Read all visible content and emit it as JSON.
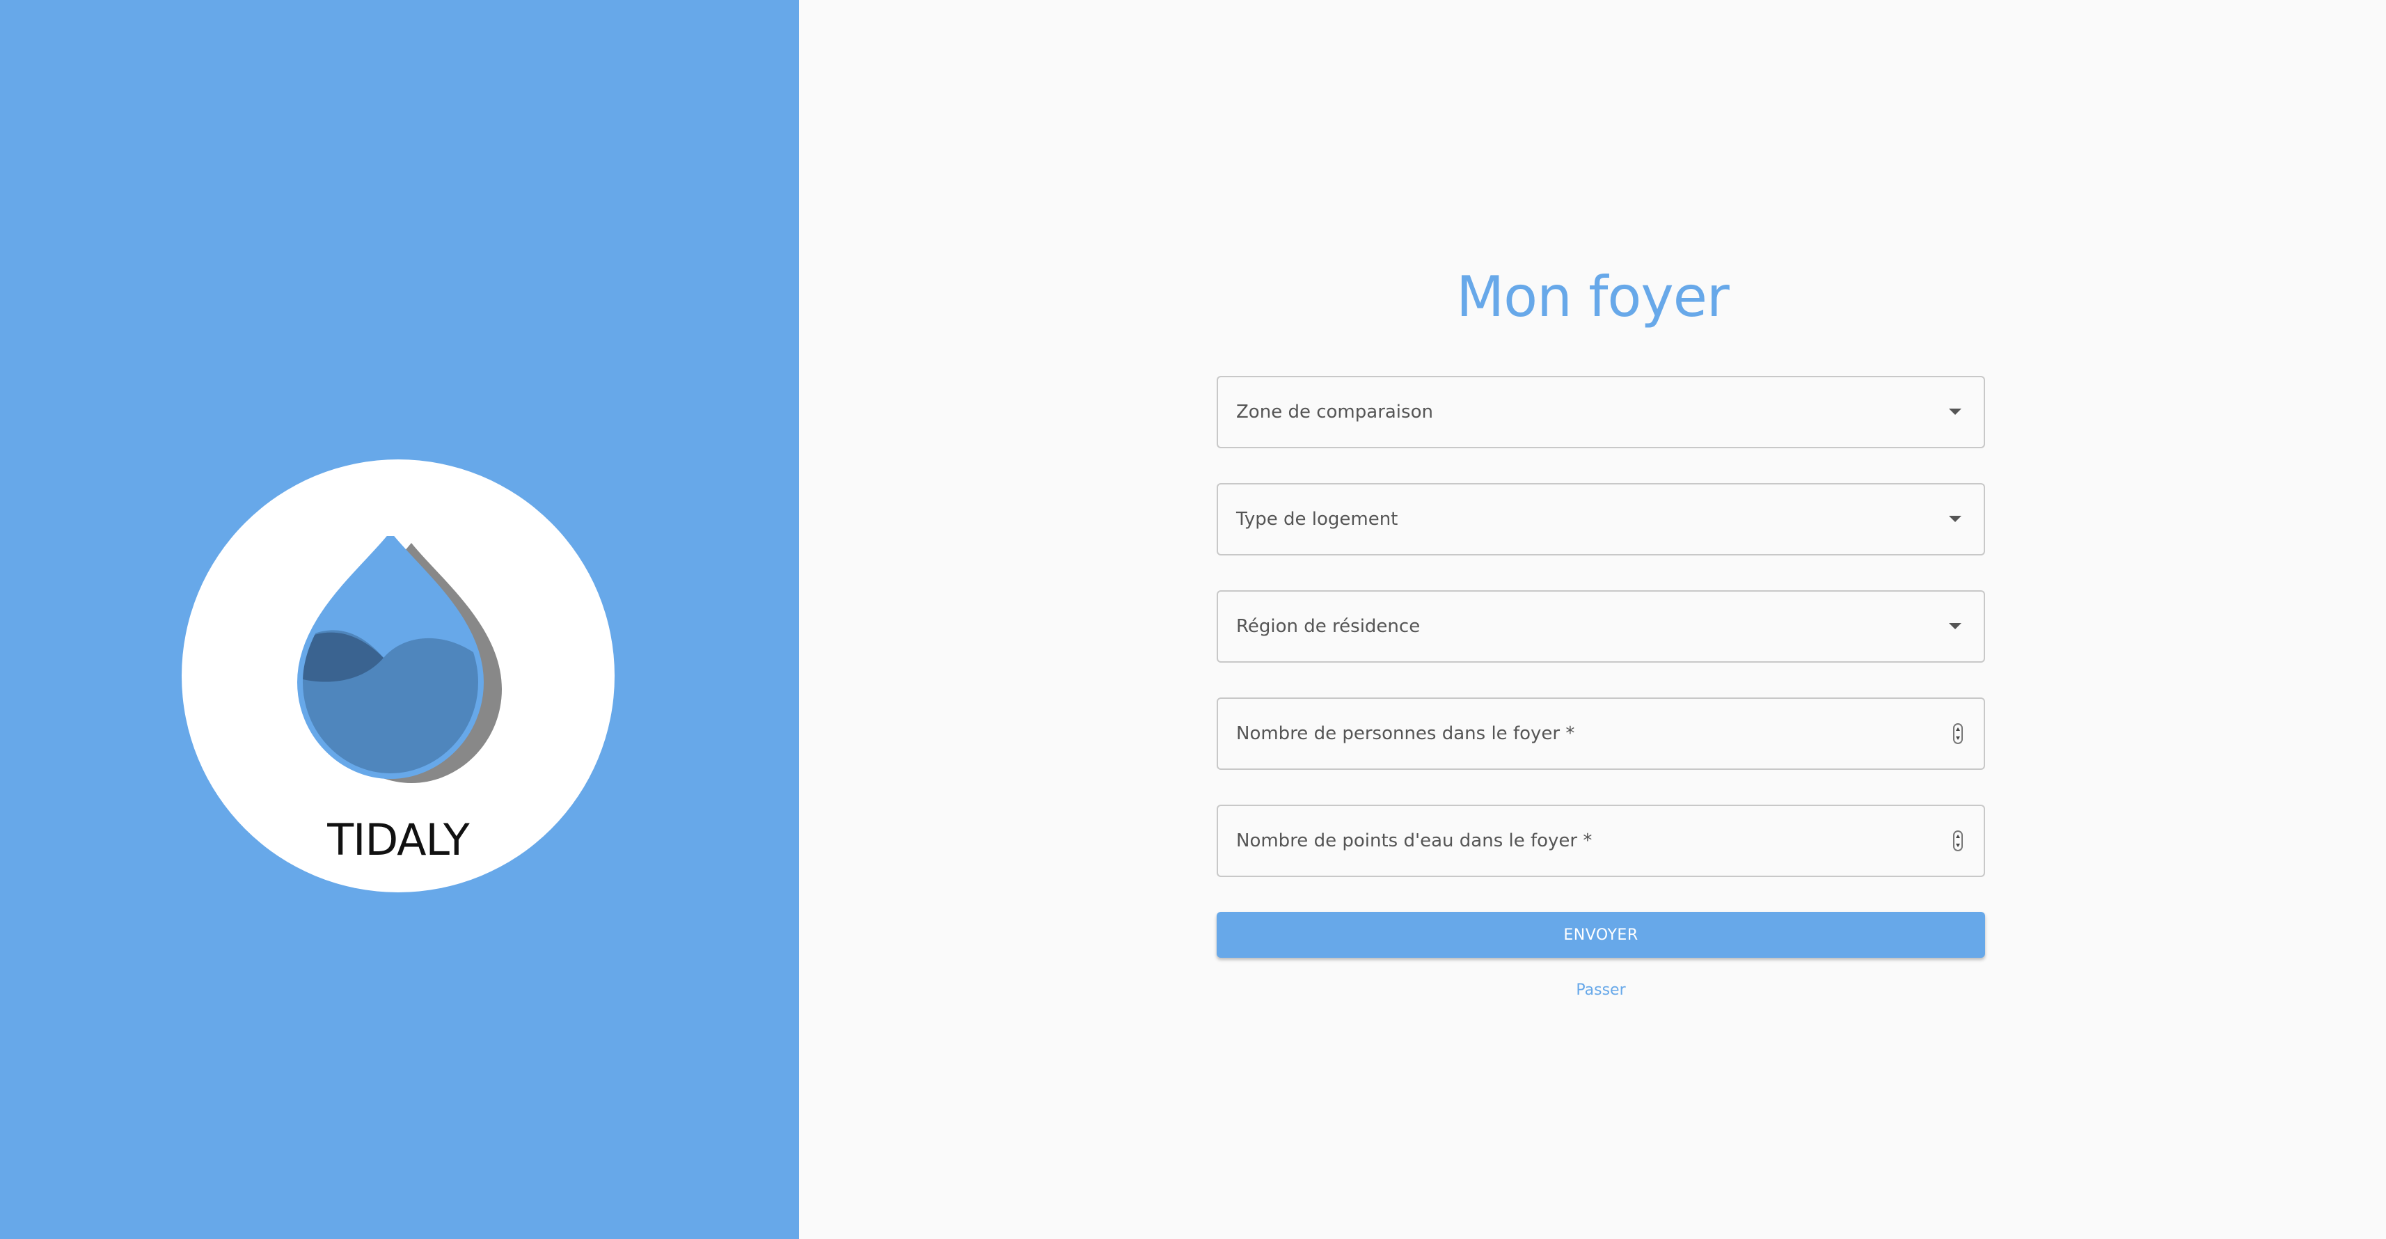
{
  "brand": {
    "name": "TIDALY",
    "logo_icon": "water-drop-icon",
    "accent_color": "#67a8e9"
  },
  "page": {
    "title": "Mon foyer"
  },
  "form": {
    "fields": [
      {
        "label": "Zone de comparaison",
        "type": "select"
      },
      {
        "label": "Type de logement",
        "type": "select"
      },
      {
        "label": "Région de résidence",
        "type": "select"
      },
      {
        "label": "Nombre de personnes dans le foyer *",
        "type": "number"
      },
      {
        "label": "Nombre de points d'eau dans le foyer *",
        "type": "number"
      }
    ],
    "submit_label": "ENVOYER",
    "skip_label": "Passer"
  }
}
